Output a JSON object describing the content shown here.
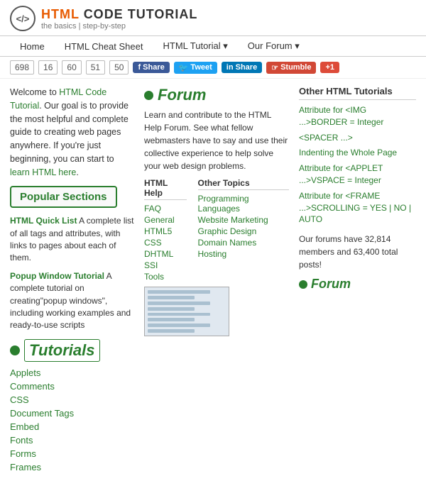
{
  "header": {
    "logo_icon": "</>",
    "logo_html": "HTML",
    "logo_rest": "CODE TUTORIAL",
    "logo_subtitle": "the basics | step-by-step"
  },
  "nav": {
    "items": [
      {
        "label": "Home",
        "has_arrow": false
      },
      {
        "label": "HTML Cheat Sheet",
        "has_arrow": false
      },
      {
        "label": "HTML Tutorial",
        "has_arrow": true
      },
      {
        "label": "Our Forum",
        "has_arrow": true
      }
    ]
  },
  "social": {
    "counts": [
      "698",
      "16",
      "60",
      "51",
      "50"
    ],
    "fb_label": "Share",
    "tw_label": "Tweet",
    "li_label": "in Share",
    "st_label": "Stumble",
    "gp_label": "+1"
  },
  "intro": {
    "text_before_link": "Welcome to ",
    "link1_text": "HTML Code Tutorial",
    "text_after_link1": ". Our goal is to provide the most helpful and complete guide to creating web pages anywhere. If you're just beginning, you can start to ",
    "link2_text": "learn HTML here",
    "text_after_link2": "."
  },
  "popular_sections": {
    "button_label": "Popular Sections"
  },
  "quick_links": [
    {
      "link_text": "HTML Quick List",
      "desc": " A complete list of all tags and attributes, with links to pages about each of them."
    },
    {
      "link_text": "Popup Window Tutorial",
      "desc": " A complete tutorial on creating\"popup windows\", including working examples and ready-to-use scripts"
    }
  ],
  "tutorials": {
    "header": "Tutorials",
    "links": [
      "Applets",
      "Comments",
      "CSS",
      "Document Tags",
      "Embed",
      "Fonts",
      "Forms",
      "Frames"
    ]
  },
  "forum": {
    "header": "Forum",
    "description": "Learn and contribute to the HTML Help Forum. See what fellow webmasters have to say and use their collective experience to help solve your web design problems.",
    "col1_header": "HTML Help",
    "col1_links": [
      "FAQ",
      "General",
      "HTML5",
      "CSS",
      "DHTML",
      "SSI",
      "Tools"
    ],
    "col2_header": "Other Topics",
    "col2_links": [
      "Programming Languages",
      "Website Marketing",
      "Graphic Design",
      "Domain Names",
      "Hosting"
    ]
  },
  "other_tutorials": {
    "header": "Other HTML Tutorials",
    "links": [
      "Attribute for <IMG ...>BORDER = Integer",
      "<SPACER ...>",
      "Indenting the Whole Page",
      "Attribute for <APPLET ...>VSPACE = Integer",
      "Attribute for <FRAME ...>SCROLLING = YES | NO | AUTO"
    ]
  },
  "forum_stats": {
    "text": "Our forums have 32,814 members and 63,400 total posts!"
  },
  "right_forum": {
    "label": "Forum"
  }
}
